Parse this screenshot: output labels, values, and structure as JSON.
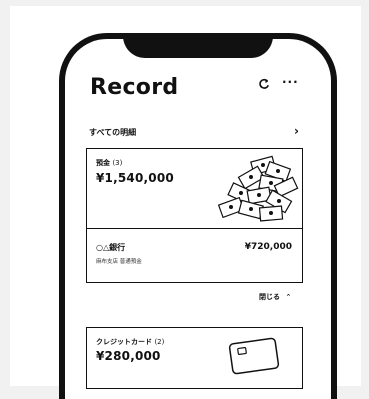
{
  "header": {
    "title": "Record",
    "refresh_icon": "refresh-icon",
    "more_label": "···"
  },
  "all_details": {
    "label": "すべての明細",
    "chevron": "›"
  },
  "deposit": {
    "label": "預金",
    "count": "(3)",
    "amount": "¥1,540,000",
    "bank": {
      "name": "○△銀行",
      "branch": "麻布支店 普通預金",
      "amount": "¥720,000"
    }
  },
  "collapse": {
    "label": "閉じる",
    "chevron": "⌃"
  },
  "credit": {
    "label": "クレジットカード",
    "count": "(2)",
    "amount": "¥280,000"
  }
}
